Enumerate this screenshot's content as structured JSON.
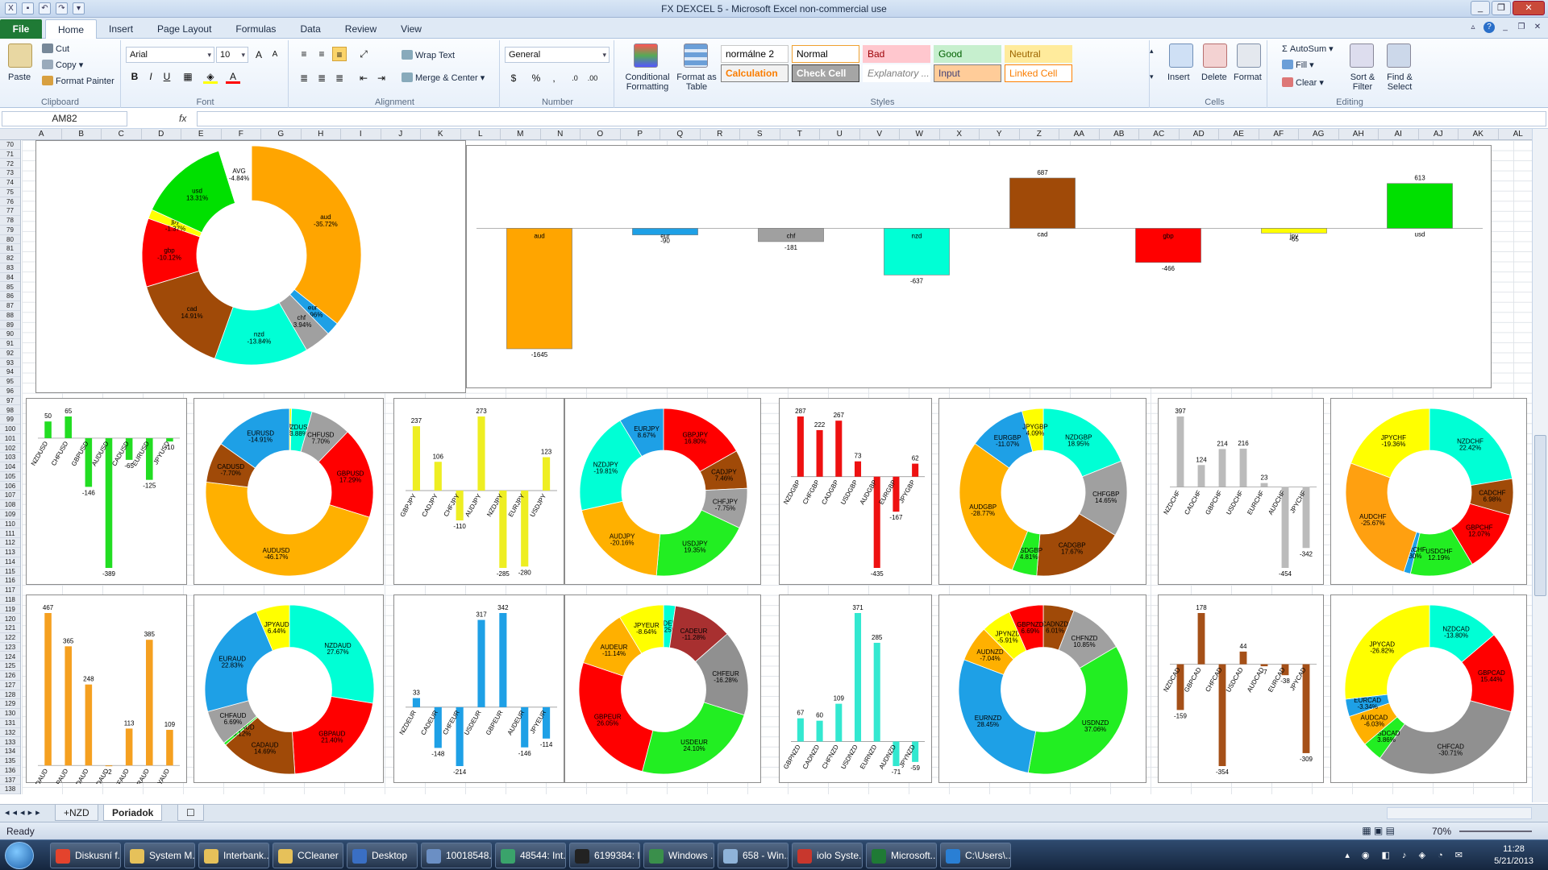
{
  "window": {
    "title": "FX DEXCEL 5  -  Microsoft Excel non-commercial use"
  },
  "ribbon": {
    "file_tab": "File",
    "tabs": [
      "Home",
      "Insert",
      "Page Layout",
      "Formulas",
      "Data",
      "Review",
      "View"
    ],
    "clipboard": {
      "paste": "Paste",
      "cut": "Cut",
      "copy": "Copy",
      "format_painter": "Format Painter",
      "label": "Clipboard"
    },
    "font": {
      "name": "Arial",
      "size": "10",
      "label": "Font"
    },
    "alignment": {
      "wrap": "Wrap Text",
      "merge": "Merge & Center",
      "label": "Alignment"
    },
    "number": {
      "format": "General",
      "label": "Number"
    },
    "styles": {
      "conditional": "Conditional Formatting",
      "format_table": "Format as Table",
      "label": "Styles",
      "cells": [
        {
          "name": "normálne 2",
          "bg": "#ffffff",
          "fg": "#000000",
          "border": "#c9c9c9"
        },
        {
          "name": "Normal",
          "bg": "#ffffff",
          "fg": "#000000",
          "border": "#f0a030"
        },
        {
          "name": "Bad",
          "bg": "#ffc7ce",
          "fg": "#9c0006",
          "border": "#ffc7ce"
        },
        {
          "name": "Good",
          "bg": "#c6efce",
          "fg": "#006100",
          "border": "#c6efce"
        },
        {
          "name": "Neutral",
          "bg": "#ffeb9c",
          "fg": "#9c6500",
          "border": "#ffeb9c"
        },
        {
          "name": "Calculation",
          "bg": "#f2f2f2",
          "fg": "#fa7d00",
          "border": "#7f7f7f"
        },
        {
          "name": "Check Cell",
          "bg": "#a5a5a5",
          "fg": "#ffffff",
          "border": "#3f3f3f"
        },
        {
          "name": "Explanatory ...",
          "bg": "#ffffff",
          "fg": "#7f7f7f",
          "border": "#ffffff"
        },
        {
          "name": "Input",
          "bg": "#ffcc99",
          "fg": "#3f3f76",
          "border": "#7f7f7f"
        },
        {
          "name": "Linked Cell",
          "bg": "#ffffff",
          "fg": "#fa7d00",
          "border": "#ff8001"
        }
      ]
    },
    "cells": {
      "insert": "Insert",
      "delete": "Delete",
      "format": "Format",
      "label": "Cells"
    },
    "editing": {
      "autosum": "AutoSum",
      "fill": "Fill",
      "clear": "Clear",
      "sort": "Sort & Filter",
      "find": "Find & Select",
      "label": "Editing"
    }
  },
  "formula_bar": {
    "name_box": "AM82",
    "fx": "fx",
    "value": ""
  },
  "grid": {
    "columns": [
      "A",
      "B",
      "C",
      "D",
      "E",
      "F",
      "G",
      "H",
      "I",
      "J",
      "K",
      "L",
      "M",
      "N",
      "O",
      "P",
      "Q",
      "R",
      "S",
      "T",
      "U",
      "V",
      "W",
      "X",
      "Y",
      "Z",
      "AA",
      "AB",
      "AC",
      "AD",
      "AE",
      "AF",
      "AG",
      "AH",
      "AI",
      "AJ",
      "AK",
      "AL",
      "AM"
    ],
    "rows": [
      "70",
      "71",
      "72",
      "73",
      "74",
      "75",
      "76",
      "77",
      "78",
      "79",
      "80",
      "81",
      "82",
      "83",
      "84",
      "85",
      "86",
      "87",
      "88",
      "89",
      "90",
      "91",
      "92",
      "93",
      "94",
      "95",
      "96",
      "97",
      "98",
      "99",
      "100",
      "101",
      "102",
      "103",
      "104",
      "105",
      "106",
      "107",
      "108",
      "109",
      "110",
      "111",
      "112",
      "113",
      "114",
      "115",
      "116",
      "117",
      "118",
      "119",
      "120",
      "121",
      "122",
      "123",
      "124",
      "125",
      "126",
      "127",
      "128",
      "129",
      "130",
      "131",
      "132",
      "133",
      "134",
      "135",
      "136",
      "137",
      "138"
    ]
  },
  "sheets": {
    "tabs": [
      "+NZD",
      "Poriadok"
    ],
    "active": "Poriadok"
  },
  "status": {
    "text": "Ready",
    "zoom": "70%"
  },
  "taskbar": {
    "items": [
      {
        "label": "Diskusní f...",
        "color": "#e4432d"
      },
      {
        "label": "System M...",
        "color": "#e6c15a"
      },
      {
        "label": "Interbank...",
        "color": "#e6c15a"
      },
      {
        "label": "CCleaner",
        "color": "#e6c15a"
      },
      {
        "label": "Desktop",
        "color": "#3a6fc4"
      },
      {
        "label": "10018548...",
        "color": "#6b8fc4"
      },
      {
        "label": "48544: Int...",
        "color": "#3aa36b"
      },
      {
        "label": "6199384: I...",
        "color": "#222222"
      },
      {
        "label": "Windows ...",
        "color": "#3a8f4b"
      },
      {
        "label": "658 - Win...",
        "color": "#8fb3d9"
      },
      {
        "label": "iolo Syste...",
        "color": "#c8372d"
      },
      {
        "label": "Microsoft...",
        "color": "#1f7a35"
      },
      {
        "label": "C:\\Users\\...",
        "color": "#2a7fd4"
      }
    ],
    "time": "11:28",
    "date": "5/21/2013"
  },
  "chart_data": [
    {
      "type": "pie",
      "id": "main-donut",
      "donut": true,
      "slices": [
        {
          "label": "aud",
          "pct": "-35.72%",
          "value": 35.72,
          "color": "#ffa500"
        },
        {
          "label": "eur",
          "pct": "-1.96%",
          "value": 1.96,
          "color": "#1ea0e6"
        },
        {
          "label": "chf",
          "pct": "-3.94%",
          "value": 3.94,
          "color": "#a0a0a0"
        },
        {
          "label": "nzd",
          "pct": "-13.84%",
          "value": 13.84,
          "color": "#00ffd5"
        },
        {
          "label": "cad",
          "pct": "14.91%",
          "value": 14.91,
          "color": "#a04a08"
        },
        {
          "label": "gbp",
          "pct": "-10.12%",
          "value": 10.12,
          "color": "#ff0000"
        },
        {
          "label": "jpy",
          "pct": "-1.37%",
          "value": 1.37,
          "color": "#ffff00"
        },
        {
          "label": "usd",
          "pct": "13.31%",
          "value": 13.31,
          "color": "#00e000"
        },
        {
          "label": "AVG",
          "pct": "-4.84%",
          "value": 4.84,
          "color": "#ffffff"
        }
      ]
    },
    {
      "type": "bar",
      "id": "main-bars",
      "categories": [
        "aud",
        "eur",
        "chf",
        "nzd",
        "cad",
        "gbp",
        "jpy",
        "usd"
      ],
      "values": [
        -1645,
        -90,
        -181,
        -637,
        687,
        -466,
        -65,
        613
      ],
      "colors": [
        "#ffa500",
        "#1ea0e6",
        "#a0a0a0",
        "#00ffd5",
        "#a04a08",
        "#ff0000",
        "#ffff00",
        "#00e000"
      ]
    },
    {
      "type": "bar",
      "id": "usd-bars",
      "color": "#22dd22",
      "categories": [
        "NZDUSD",
        "CHFUSD",
        "GBPUSD",
        "AUDUSD",
        "CADUSD",
        "EURUSD",
        "JPYUSD"
      ],
      "values": [
        50,
        65,
        -146,
        -389,
        -65,
        -125,
        -10
      ]
    },
    {
      "type": "pie",
      "id": "usd-donut",
      "donut": true,
      "slices": [
        {
          "label": "JPYUSD",
          "pct": "-0.39%",
          "value": 0.39,
          "color": "#ffff00"
        },
        {
          "label": "NZDUSD",
          "pct": "3.88%",
          "value": 3.88,
          "color": "#00ffd5"
        },
        {
          "label": "CHFUSD",
          "pct": "7.70%",
          "value": 7.7,
          "color": "#a0a0a0"
        },
        {
          "label": "GBPUSD",
          "pct": "17.29%",
          "value": 17.29,
          "color": "#ff0000"
        },
        {
          "label": "AUDUSD",
          "pct": "-46.17%",
          "value": 46.17,
          "color": "#ffb000"
        },
        {
          "label": "CADUSD",
          "pct": "-7.70%",
          "value": 7.7,
          "color": "#a04a08"
        },
        {
          "label": "EURUSD",
          "pct": "-14.91%",
          "value": 14.91,
          "color": "#1ea0e6"
        }
      ]
    },
    {
      "type": "bar",
      "id": "jpy-bars",
      "color": "#eeee22",
      "categories": [
        "GBPJPY",
        "CADJPY",
        "CHFJPY",
        "AUDJPY",
        "NZDJPY",
        "EURJPY",
        "USDJPY"
      ],
      "values": [
        237,
        106,
        -110,
        273,
        -285,
        -280,
        123
      ]
    },
    {
      "type": "pie",
      "id": "jpy-donut",
      "donut": true,
      "slices": [
        {
          "label": "GBPJPY",
          "pct": "16.80%",
          "value": 16.8,
          "color": "#ff0000"
        },
        {
          "label": "CADJPY",
          "pct": "7.46%",
          "value": 7.46,
          "color": "#a04a08"
        },
        {
          "label": "CHFJPY",
          "pct": "-7.75%",
          "value": 7.75,
          "color": "#a0a0a0"
        },
        {
          "label": "USDJPY",
          "pct": "19.35%",
          "value": 19.35,
          "color": "#22ee22"
        },
        {
          "label": "AUDJPY",
          "pct": "-20.16%",
          "value": 20.16,
          "color": "#ffb000"
        },
        {
          "label": "NZDJPY",
          "pct": "-19.81%",
          "value": 19.81,
          "color": "#00ffd5"
        },
        {
          "label": "EURJPY",
          "pct": "8.67%",
          "value": 8.67,
          "color": "#1ea0e6"
        }
      ]
    },
    {
      "type": "bar",
      "id": "gbp-bars",
      "color": "#ee1111",
      "categories": [
        "NZDGBP",
        "CHFGBP",
        "CADGBP",
        "USDGBP",
        "AUDGBP",
        "EURGBP",
        "JPYGBP"
      ],
      "values": [
        287,
        222,
        267,
        73,
        -435,
        -167,
        62
      ]
    },
    {
      "type": "pie",
      "id": "gbp-donut",
      "donut": true,
      "slices": [
        {
          "label": "NZDGBP",
          "pct": "18.95%",
          "value": 18.95,
          "color": "#00ffd5"
        },
        {
          "label": "CHFGBP",
          "pct": "14.65%",
          "value": 14.65,
          "color": "#a0a0a0"
        },
        {
          "label": "CADGBP",
          "pct": "17.67%",
          "value": 17.67,
          "color": "#a04a08"
        },
        {
          "label": "USDGBP",
          "pct": "4.81%",
          "value": 4.81,
          "color": "#22ee22"
        },
        {
          "label": "AUDGBP",
          "pct": "-28.77%",
          "value": 28.77,
          "color": "#ffb000"
        },
        {
          "label": "EURGBP",
          "pct": "-11.07%",
          "value": 11.07,
          "color": "#1ea0e6"
        },
        {
          "label": "JPYGBP",
          "pct": "4.09%",
          "value": 4.09,
          "color": "#ffff00"
        }
      ]
    },
    {
      "type": "bar",
      "id": "chf-bars",
      "color": "#bbbbbb",
      "categories": [
        "NZDCHF",
        "CADCHF",
        "GBPCHF",
        "USDCHF",
        "EURCHF",
        "AUDCHF",
        "JPYCHF"
      ],
      "values": [
        397,
        124,
        214,
        216,
        23,
        -454,
        -342
      ]
    },
    {
      "type": "pie",
      "id": "chf-donut",
      "donut": true,
      "slices": [
        {
          "label": "NZDCHF",
          "pct": "22.42%",
          "value": 22.42,
          "color": "#00ffd5"
        },
        {
          "label": "CADCHF",
          "pct": "6.98%",
          "value": 6.98,
          "color": "#a04a08"
        },
        {
          "label": "GBPCHF",
          "pct": "12.07%",
          "value": 12.07,
          "color": "#ff0000"
        },
        {
          "label": "USDCHF",
          "pct": "12.19%",
          "value": 12.19,
          "color": "#22ee22"
        },
        {
          "label": "EURCHF",
          "pct": "1.30%",
          "value": 1.3,
          "color": "#1ea0e6"
        },
        {
          "label": "AUDCHF",
          "pct": "-25.67%",
          "value": 25.67,
          "color": "#ffa010"
        },
        {
          "label": "JPYCHF",
          "pct": "-19.36%",
          "value": 19.36,
          "color": "#ffff00"
        }
      ]
    },
    {
      "type": "bar",
      "id": "aud-bars",
      "color": "#f5a020",
      "categories": [
        "NZDAUD",
        "GBPAUD",
        "CADAUD",
        "USDAUD",
        "CHFAUD",
        "EURAUD",
        "JPYAUD"
      ],
      "values": [
        467,
        365,
        248,
        -2,
        113,
        385,
        109
      ]
    },
    {
      "type": "pie",
      "id": "aud-donut",
      "donut": true,
      "slices": [
        {
          "label": "NZDAUD",
          "pct": "27.67%",
          "value": 27.67,
          "color": "#00ffd5"
        },
        {
          "label": "GBPAUD",
          "pct": "21.40%",
          "value": 21.4,
          "color": "#ff0000"
        },
        {
          "label": "CADAUD",
          "pct": "14.69%",
          "value": 14.69,
          "color": "#a04a08"
        },
        {
          "label": "USDAUD",
          "pct": "-0.12%",
          "value": 0.5,
          "color": "#22ee22"
        },
        {
          "label": "CHFAUD",
          "pct": "6.69%",
          "value": 6.69,
          "color": "#a0a0a0"
        },
        {
          "label": "EURAUD",
          "pct": "22.83%",
          "value": 22.83,
          "color": "#1ea0e6"
        },
        {
          "label": "JPYAUD",
          "pct": "6.44%",
          "value": 6.44,
          "color": "#ffff00"
        }
      ]
    },
    {
      "type": "bar",
      "id": "eur-bars",
      "color": "#1ea0e6",
      "categories": [
        "NZDEUR",
        "CADEUR",
        "CHFEUR",
        "USDEUR",
        "GBPEUR",
        "AUDEUR",
        "JPYEUR"
      ],
      "values": [
        33,
        -148,
        -214,
        317,
        342,
        -146,
        -114
      ]
    },
    {
      "type": "pie",
      "id": "eur-donut",
      "donut": true,
      "slices": [
        {
          "label": "NZDEUR",
          "pct": "2.25%",
          "value": 2.25,
          "color": "#00ffd5"
        },
        {
          "label": "CADEUR",
          "pct": "-11.28%",
          "value": 11.28,
          "color": "#a83030"
        },
        {
          "label": "CHFEUR",
          "pct": "-16.28%",
          "value": 16.28,
          "color": "#909090"
        },
        {
          "label": "USDEUR",
          "pct": "24.10%",
          "value": 24.1,
          "color": "#22ee22"
        },
        {
          "label": "GBPEUR",
          "pct": "26.05%",
          "value": 26.05,
          "color": "#ff0000"
        },
        {
          "label": "AUDEUR",
          "pct": "-11.14%",
          "value": 11.14,
          "color": "#ffb000"
        },
        {
          "label": "JPYEUR",
          "pct": "-8.64%",
          "value": 8.64,
          "color": "#ffff00"
        }
      ]
    },
    {
      "type": "bar",
      "id": "nzd-bars",
      "color": "#33e8d0",
      "categories": [
        "GBPNZD",
        "CADNZD",
        "CHFNZD",
        "USDNZD",
        "EURNZD",
        "AUDNZD",
        "JPYNZD"
      ],
      "values": [
        67,
        60,
        109,
        371,
        285,
        -71,
        -59
      ]
    },
    {
      "type": "pie",
      "id": "nzd-donut",
      "donut": true,
      "slices": [
        {
          "label": "CADNZD",
          "pct": "6.01%",
          "value": 6.01,
          "color": "#a04a08"
        },
        {
          "label": "CHFNZD",
          "pct": "10.85%",
          "value": 10.85,
          "color": "#a0a0a0"
        },
        {
          "label": "USDNZD",
          "pct": "37.06%",
          "value": 37.06,
          "color": "#22ee22"
        },
        {
          "label": "EURNZD",
          "pct": "28.45%",
          "value": 28.45,
          "color": "#1ea0e6"
        },
        {
          "label": "AUDNZD",
          "pct": "-7.04%",
          "value": 7.04,
          "color": "#ffb000"
        },
        {
          "label": "JPYNZD",
          "pct": "-5.91%",
          "value": 5.91,
          "color": "#ffff00"
        },
        {
          "label": "GBPNZD",
          "pct": "6.69%",
          "value": 6.69,
          "color": "#ff0000"
        }
      ]
    },
    {
      "type": "bar",
      "id": "cad-bars",
      "color": "#a55018",
      "categories": [
        "NZDCAD",
        "GBPCAD",
        "CHFCAD",
        "USDCAD",
        "AUDCAD",
        "EURCAD",
        "JPYCAD"
      ],
      "values": [
        -159,
        178,
        -354,
        44,
        -7,
        -38,
        -309
      ]
    },
    {
      "type": "pie",
      "id": "cad-donut",
      "donut": true,
      "slices": [
        {
          "label": "NZDCAD",
          "pct": "-13.80%",
          "value": 13.8,
          "color": "#00ffd5"
        },
        {
          "label": "GBPCAD",
          "pct": "15.44%",
          "value": 15.44,
          "color": "#ff0000"
        },
        {
          "label": "CHFCAD",
          "pct": "-30.71%",
          "value": 30.71,
          "color": "#909090"
        },
        {
          "label": "USDCAD",
          "pct": "3.86%",
          "value": 3.86,
          "color": "#22ee22"
        },
        {
          "label": "AUDCAD",
          "pct": "-6.03%",
          "value": 6.03,
          "color": "#ffb000"
        },
        {
          "label": "EURCAD",
          "pct": "-3.34%",
          "value": 3.34,
          "color": "#1ea0e6"
        },
        {
          "label": "JPYCAD",
          "pct": "-26.82%",
          "value": 26.82,
          "color": "#ffff00"
        }
      ]
    }
  ]
}
